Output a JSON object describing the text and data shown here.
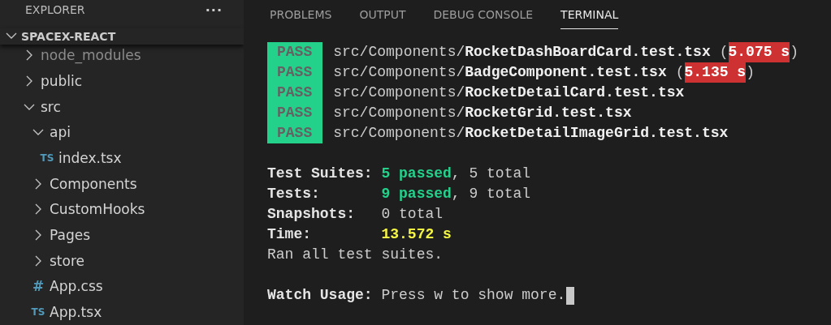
{
  "sidebar": {
    "title": "EXPLORER",
    "more": "···",
    "section": {
      "label": "SPACEX-REACT",
      "expanded": true
    },
    "tree": [
      {
        "label": "node_modules",
        "kind": "folder",
        "expanded": false,
        "dimmed": true
      },
      {
        "label": "public",
        "kind": "folder",
        "expanded": false,
        "dimmed": false
      },
      {
        "label": "src",
        "kind": "folder",
        "expanded": true,
        "dimmed": false,
        "children": [
          {
            "label": "api",
            "kind": "folder",
            "expanded": true,
            "dimmed": false,
            "children": [
              {
                "label": "index.tsx",
                "kind": "ts",
                "icon": "TS",
                "dimmed": false
              }
            ]
          },
          {
            "label": "Components",
            "kind": "folder",
            "expanded": false,
            "dimmed": false
          },
          {
            "label": "CustomHooks",
            "kind": "folder",
            "expanded": false,
            "dimmed": false
          },
          {
            "label": "Pages",
            "kind": "folder",
            "expanded": false,
            "dimmed": false
          },
          {
            "label": "store",
            "kind": "folder",
            "expanded": false,
            "dimmed": false
          },
          {
            "label": "App.css",
            "kind": "css",
            "icon": "#",
            "dimmed": false
          },
          {
            "label": "App.tsx",
            "kind": "ts",
            "icon": "TS",
            "dimmed": false
          }
        ]
      }
    ]
  },
  "panel": {
    "tabs": [
      {
        "label": "PROBLEMS",
        "selected": false
      },
      {
        "label": "OUTPUT",
        "selected": false
      },
      {
        "label": "DEBUG CONSOLE",
        "selected": false
      },
      {
        "label": "TERMINAL",
        "selected": true
      }
    ],
    "results": [
      [
        {
          "text": "PASS",
          "kind": "badge"
        },
        {
          "text": "src/Components/",
          "kind": "path"
        },
        {
          "text": "RocketDashBoardCard.test.tsx",
          "kind": "file"
        },
        {
          "text": "(",
          "kind": "path"
        },
        {
          "text": "5.075 s",
          "kind": "slow"
        },
        {
          "text": ")",
          "kind": "path"
        }
      ],
      [
        {
          "text": "PASS",
          "kind": "badge"
        },
        {
          "text": "src/Components/",
          "kind": "path"
        },
        {
          "text": "BadgeComponent.test.tsx",
          "kind": "file"
        },
        {
          "text": "(",
          "kind": "path"
        },
        {
          "text": "5.135 s",
          "kind": "slow"
        },
        {
          "text": ")",
          "kind": "path"
        }
      ],
      [
        {
          "text": "PASS",
          "kind": "badge"
        },
        {
          "text": "src/Components/",
          "kind": "path"
        },
        {
          "text": "RocketDetailCard.test.tsx",
          "kind": "file"
        }
      ],
      [
        {
          "text": "PASS",
          "kind": "badge"
        },
        {
          "text": "src/Components/",
          "kind": "path"
        },
        {
          "text": "RocketGrid.test.tsx",
          "kind": "file"
        }
      ],
      [
        {
          "text": "PASS",
          "kind": "badge"
        },
        {
          "text": "src/Components/",
          "kind": "path"
        },
        {
          "text": "RocketDetailImageGrid.test.tsx",
          "kind": "file"
        }
      ]
    ],
    "summary": [
      {
        "label": "Test Suites:",
        "segments": [
          {
            "text": "5 passed",
            "kind": "passed"
          },
          {
            "text": ", 5 total",
            "kind": "path"
          }
        ]
      },
      {
        "label": "Tests:",
        "segments": [
          {
            "text": "9 passed",
            "kind": "passed"
          },
          {
            "text": ", 9 total",
            "kind": "path"
          }
        ]
      },
      {
        "label": "Snapshots:",
        "segments": [
          {
            "text": "0 total",
            "kind": "path"
          }
        ]
      },
      {
        "label": "Time:",
        "segments": [
          {
            "text": "13.572 s",
            "kind": "time"
          }
        ]
      }
    ],
    "message": "Ran all test suites.",
    "prompt": {
      "label": "Watch Usage:",
      "text": "Press w to show more."
    }
  }
}
